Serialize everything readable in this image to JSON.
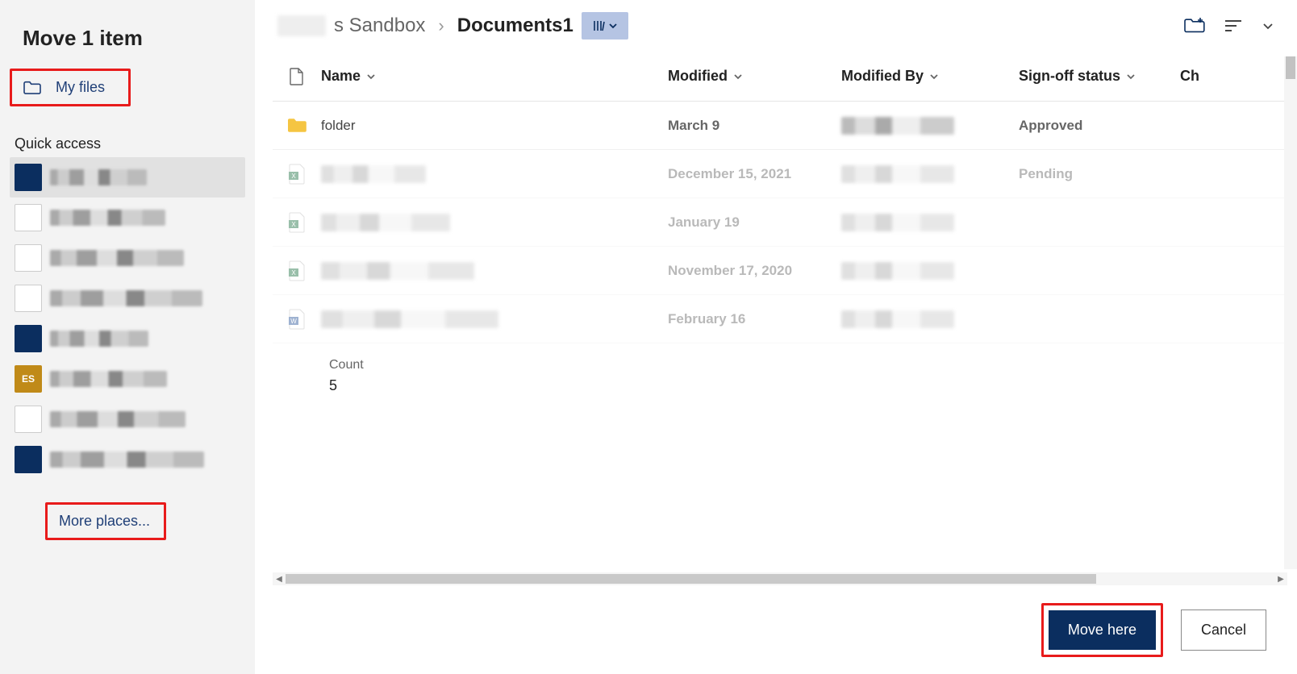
{
  "sidebar": {
    "title": "Move 1 item",
    "my_files_label": "My files",
    "quick_access_heading": "Quick access",
    "items": [
      {
        "thumb_bg": "#0b2e5f",
        "thumb_label": "",
        "selected": true
      },
      {
        "thumb_bg": "#ffffff",
        "thumb_label": "",
        "selected": false
      },
      {
        "thumb_bg": "#ffffff",
        "thumb_label": "",
        "selected": false
      },
      {
        "thumb_bg": "#ffffff",
        "thumb_label": "",
        "selected": false
      },
      {
        "thumb_bg": "#0b2e5f",
        "thumb_label": "",
        "selected": false
      },
      {
        "thumb_bg": "#c08a18",
        "thumb_label": "ES",
        "selected": false
      },
      {
        "thumb_bg": "#ffffff",
        "thumb_label": "",
        "selected": false
      },
      {
        "thumb_bg": "#0b2e5f",
        "thumb_label": "",
        "selected": false
      }
    ],
    "more_places_label": "More places..."
  },
  "breadcrumb": {
    "segment1_suffix": "s Sandbox",
    "separator": "›",
    "current": "Documents1"
  },
  "columns": {
    "name": "Name",
    "modified": "Modified",
    "modified_by": "Modified By",
    "signoff": "Sign-off status",
    "overflow": "Ch"
  },
  "rows": [
    {
      "type": "folder",
      "name": "folder",
      "modified": "March 9",
      "signoff": "Approved",
      "dim": false
    },
    {
      "type": "excel",
      "name": "",
      "modified": "December 15, 2021",
      "signoff": "Pending",
      "dim": true
    },
    {
      "type": "excel",
      "name": "",
      "modified": "January 19",
      "signoff": "",
      "dim": true
    },
    {
      "type": "excel",
      "name": "",
      "modified": "November 17, 2020",
      "signoff": "",
      "dim": true
    },
    {
      "type": "word",
      "name": "",
      "modified": "February 16",
      "signoff": "",
      "dim": true
    }
  ],
  "count": {
    "label": "Count",
    "value": "5"
  },
  "footer": {
    "primary": "Move here",
    "secondary": "Cancel"
  }
}
